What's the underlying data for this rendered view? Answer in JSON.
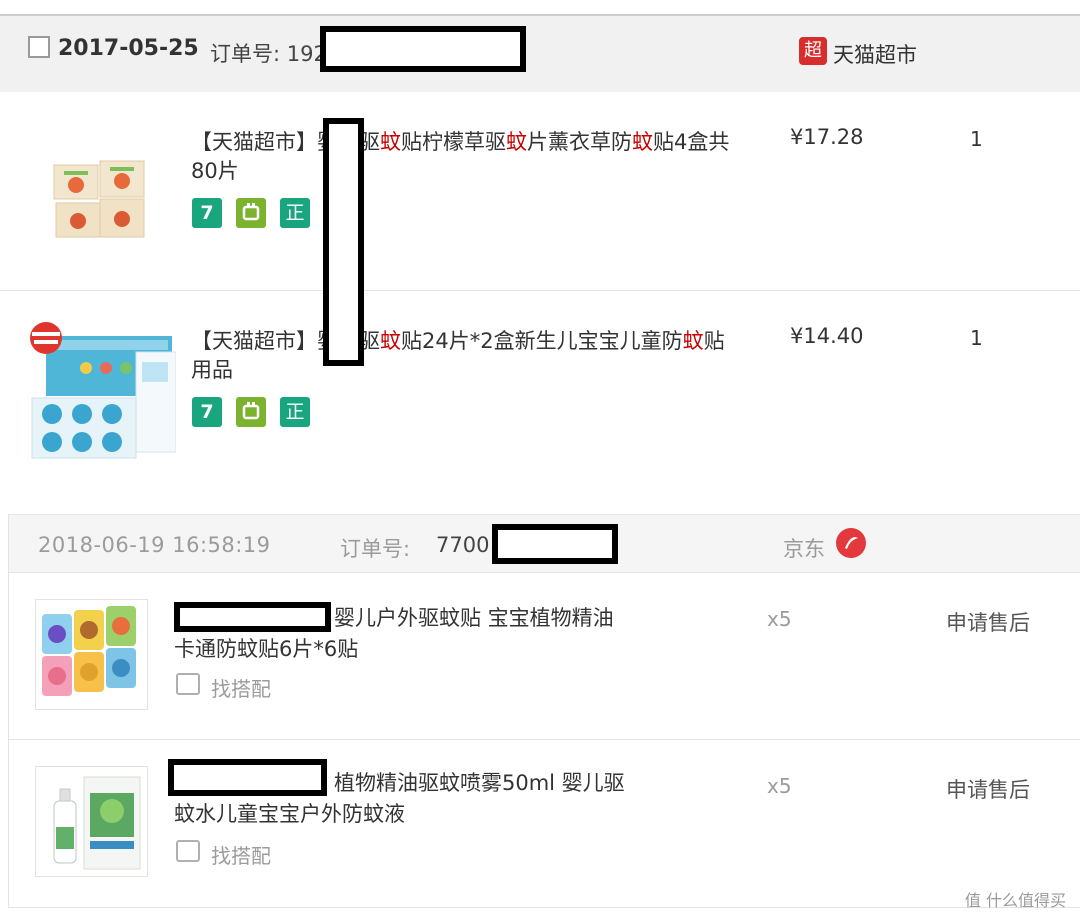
{
  "tmall_order": {
    "date": "2017-05-25",
    "order_label": "订单号: 192",
    "shop_icon_text": "超",
    "shop_name": "天猫超市",
    "items": [
      {
        "title_prefix": "【天猫超市】",
        "title_parts": [
          {
            "text": "婴儿驱",
            "hl": false
          },
          {
            "text": "蚊",
            "hl": true
          },
          {
            "text": "贴柠檬草驱",
            "hl": false
          },
          {
            "text": "蚊",
            "hl": true
          },
          {
            "text": "片薰衣草防",
            "hl": false
          },
          {
            "text": "蚊",
            "hl": true
          },
          {
            "text": "贴4盒共80片",
            "hl": false
          }
        ],
        "price": "¥17.28",
        "qty": "1",
        "badges": [
          "7",
          "",
          "正"
        ]
      },
      {
        "title_prefix": "【天猫超市】",
        "title_parts": [
          {
            "text": "婴儿驱",
            "hl": false
          },
          {
            "text": "蚊",
            "hl": true
          },
          {
            "text": "贴24片*2盒新生儿宝宝儿童防",
            "hl": false
          },
          {
            "text": "蚊",
            "hl": true
          },
          {
            "text": "贴用品",
            "hl": false
          }
        ],
        "price": "¥14.40",
        "qty": "1",
        "badges": [
          "7",
          "",
          "正"
        ]
      }
    ]
  },
  "jd_order": {
    "time": "2018-06-19 16:58:19",
    "order_label": "订单号:",
    "order_number": "7700",
    "shop_name": "京东",
    "items": [
      {
        "title": "婴儿户外驱蚊贴 宝宝植物精油卡通防蚊贴6片*6贴",
        "match_label": "找搭配",
        "qty": "x5",
        "after_sale": "申请售后"
      },
      {
        "title": "植物精油驱蚊喷雾50ml 婴儿驱蚊水儿童宝宝户外防蚊液",
        "match_label": "找搭配",
        "qty": "x5",
        "after_sale": "申请售后"
      }
    ]
  },
  "watermark": "值 什么值得买",
  "colors": {
    "keyword_red": "#c80000",
    "tmall_red": "#d72d2d",
    "jd_red": "#e4393c",
    "badge_green": "#19a67e",
    "badge_lime": "#7bb32e"
  }
}
